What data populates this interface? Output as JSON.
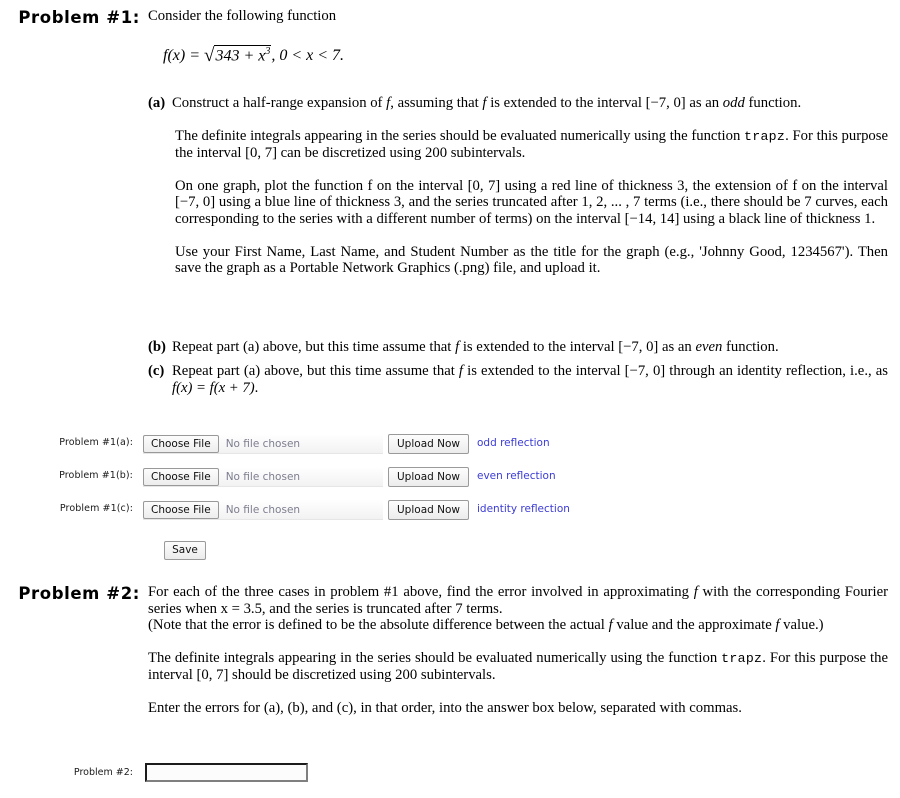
{
  "problem1": {
    "heading": "Problem #1:",
    "intro": "Consider the following function",
    "formula": {
      "lhs": "f(x) =",
      "radical_glyph": "√",
      "radicand_base": "343 + x",
      "radicand_exponent": "3",
      "domain": ", 0 < x < 7."
    },
    "items": [
      {
        "marker": "(a)",
        "text_before_f1": "Construct a half-range expansion of ",
        "text_mid": ", assuming that ",
        "text_after": " is extended to the interval [−7, 0] as an ",
        "emphasis": "odd",
        "text_end": " function.",
        "paragraphs": [
          {
            "part1": "The definite integrals appearing in the series should be evaluated numerically using the function ",
            "mono": "trapz",
            "part2": ". For this purpose the interval [0, 7] can be discretized using 200 subintervals."
          },
          {
            "text": "On one graph, plot the function f on the interval [0, 7] using a red line of thickness 3, the extension of f on the interval [−7, 0] using a blue line of thickness 3, and the series truncated after 1, 2, ... , 7 terms (i.e., there should be 7 curves, each corresponding to the series with a different number of terms) on the interval [−14, 14] using a black line of thickness 1."
          },
          {
            "text": "Use your First Name, Last Name, and Student Number as the title for the graph (e.g., 'Johnny Good, 1234567'). Then save the graph as a Portable Network Graphics (.png) file, and upload it."
          }
        ]
      },
      {
        "marker": "(b)",
        "text_before": "Repeat part (a) above, but this time assume that ",
        "text_after": " is extended to the interval [−7, 0] as an ",
        "emphasis": "even",
        "text_end": " function."
      },
      {
        "marker": "(c)",
        "text_before": "Repeat part (a) above, but this time assume that ",
        "text_after": " is extended to the interval [−7, 0] through an identity reflection, i.e., as ",
        "identity_formula": "f(x) = f(x + 7)",
        "text_end": "."
      }
    ],
    "uploads": [
      {
        "label": "Problem #1(a):",
        "choose_button": "Choose File",
        "file_status": "No file chosen",
        "upload_button": "Upload Now",
        "note": "odd reflection"
      },
      {
        "label": "Problem #1(b):",
        "choose_button": "Choose File",
        "file_status": "No file chosen",
        "upload_button": "Upload Now",
        "note": "even reflection"
      },
      {
        "label": "Problem #1(c):",
        "choose_button": "Choose File",
        "file_status": "No file chosen",
        "upload_button": "Upload Now",
        "note": "identity reflection"
      }
    ],
    "save_button": "Save"
  },
  "problem2": {
    "heading": "Problem #2:",
    "paragraph1_a": "For each of the three cases in problem #1 above, find the error involved in approximating ",
    "paragraph1_b": " with the corresponding Fourier series when x = 3.5, and the series is truncated after 7 terms.",
    "paragraph2_a": "(Note that the error is defined to be the absolute difference between the actual ",
    "paragraph2_b": " value and the approximate ",
    "paragraph2_c": " value.)",
    "paragraph3_a": "The definite integrals appearing in the series should be evaluated numerically using the function ",
    "paragraph3_mono": "trapz",
    "paragraph3_b": ". For this purpose the interval [0, 7] should be discretized using 200 subintervals.",
    "paragraph4": "Enter the errors for (a), (b), and (c), in that order, into the answer box below, separated with commas.",
    "answer_label": "Problem #2:",
    "answer_value": "",
    "answer_placeholder": ""
  },
  "colors": {
    "link_blue": "#3b3bd6",
    "placeholder_gray": "#7d7d8f",
    "text_black": "#000000"
  }
}
